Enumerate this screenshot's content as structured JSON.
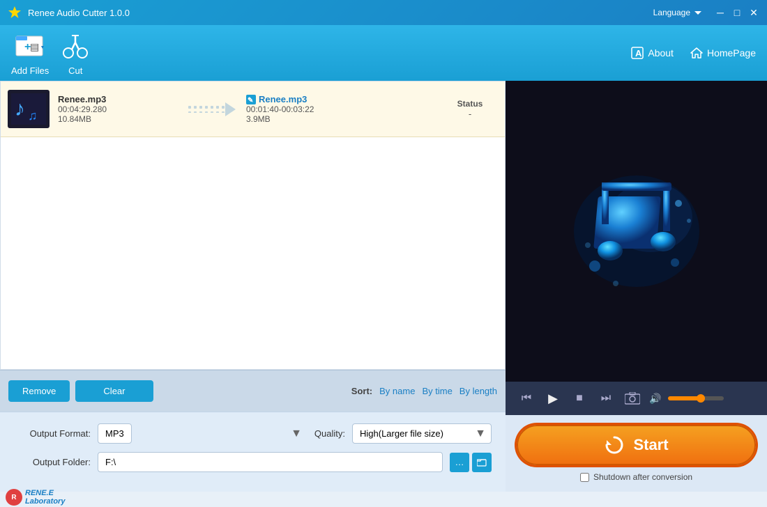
{
  "app": {
    "title": "Renee Audio Cutter 1.0.0",
    "language": "Language",
    "toolbar": {
      "add_files": "Add Files",
      "cut": "Cut",
      "about": "About",
      "homepage": "HomePage"
    }
  },
  "file_list": {
    "item": {
      "source_name": "Renee.mp3",
      "source_duration": "00:04:29.280",
      "source_size": "10.84MB",
      "output_name": "Renee.mp3",
      "output_range": "00:01:40-00:03:22",
      "output_size": "3.9MB",
      "status_label": "Status",
      "status_value": "-"
    }
  },
  "bottom_bar": {
    "remove": "Remove",
    "clear": "Clear",
    "sort_label": "Sort:",
    "sort_by_name": "By name",
    "sort_by_time": "By time",
    "sort_by_length": "By length"
  },
  "output": {
    "format_label": "Output Format:",
    "format_value": "MP3",
    "quality_label": "Quality:",
    "quality_value": "High(Larger file size)",
    "folder_label": "Output Folder:",
    "folder_value": "F:\\"
  },
  "player": {
    "volume": 60
  },
  "start": {
    "label": "Start",
    "shutdown": "Shutdown after conversion"
  },
  "renee": {
    "name": "RENE.E",
    "sub": "Laboratory"
  }
}
